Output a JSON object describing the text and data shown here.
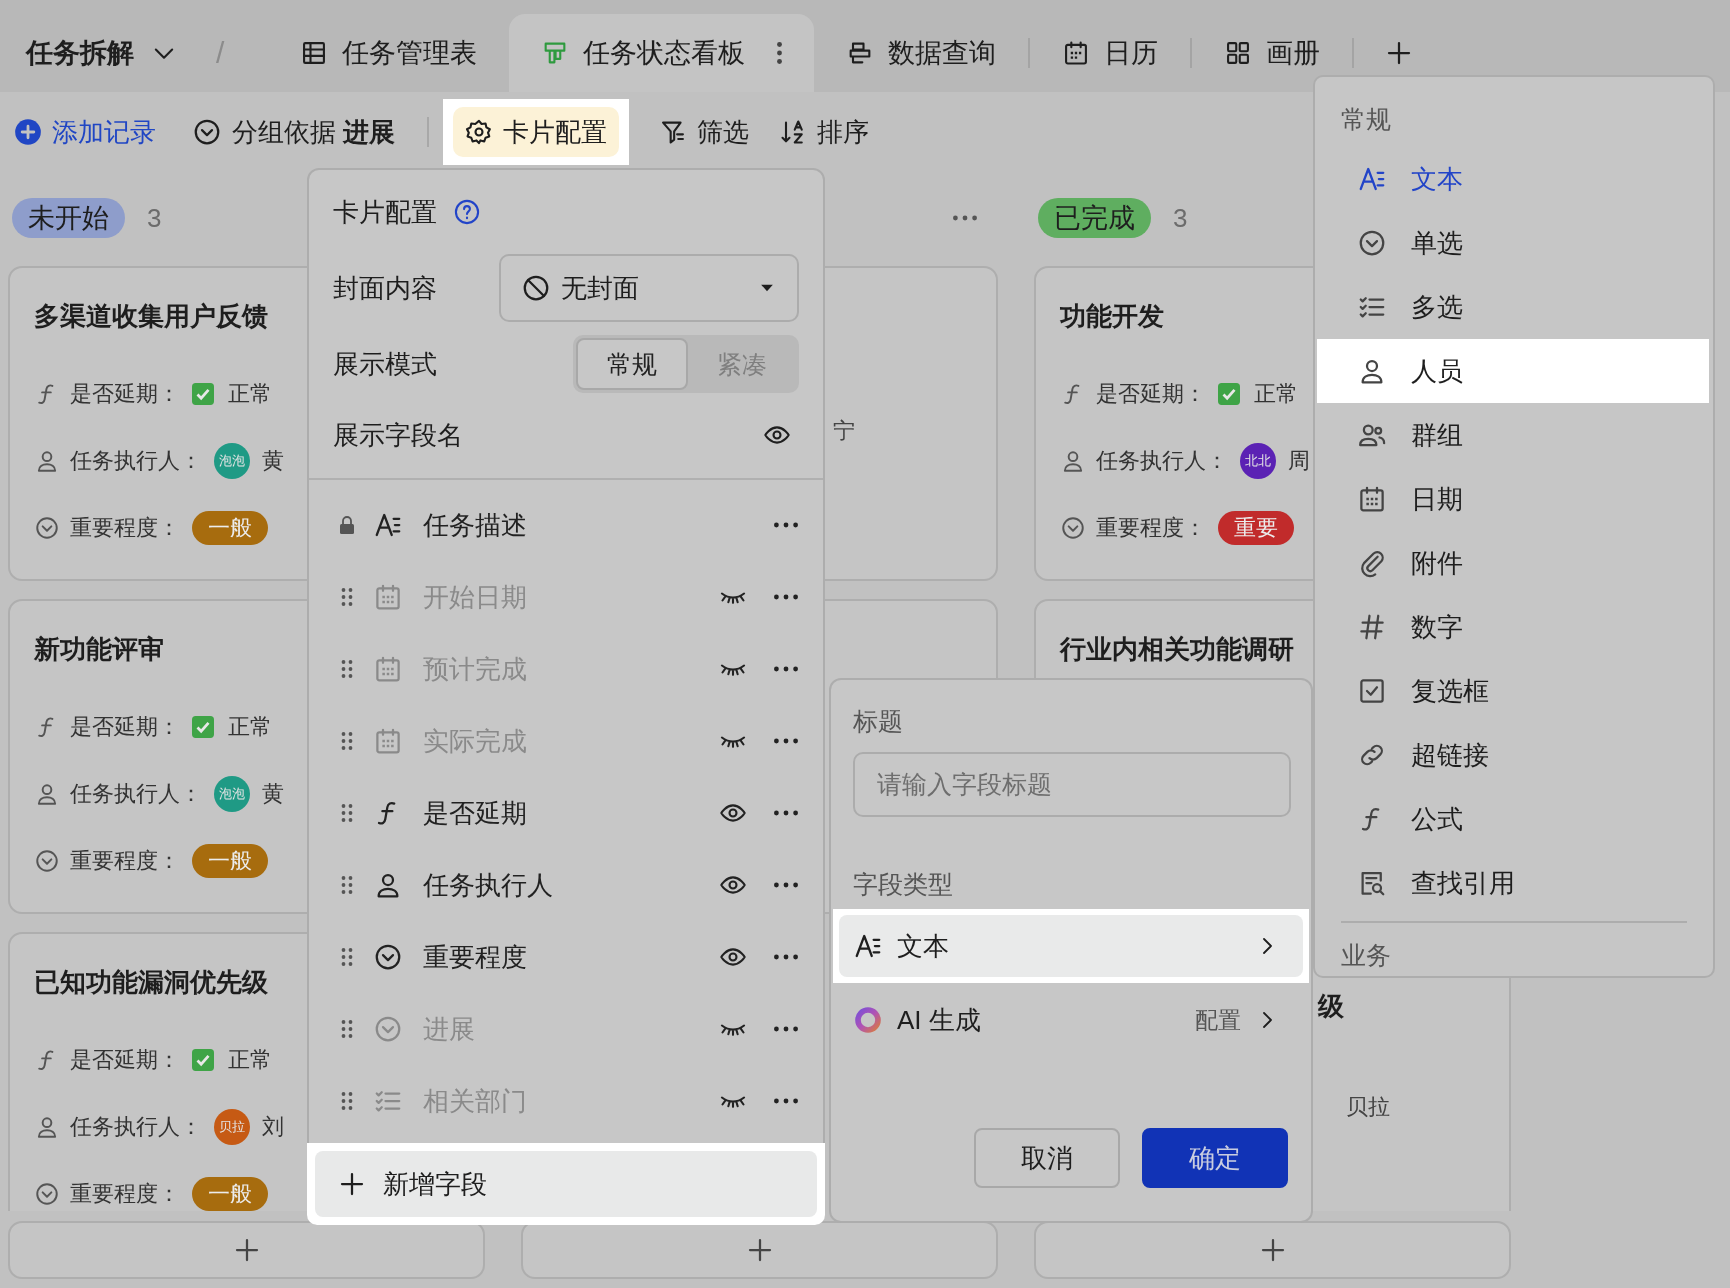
{
  "header": {
    "title": "任务拆解",
    "separator": "/"
  },
  "tabs": [
    {
      "label": "任务管理表",
      "kind": "grid",
      "selected": false,
      "has_menu": false
    },
    {
      "label": "任务状态看板",
      "kind": "kanban",
      "selected": true,
      "has_menu": true
    },
    {
      "label": "数据查询",
      "kind": "query",
      "selected": false,
      "has_menu": false
    },
    {
      "label": "日历",
      "kind": "calendar",
      "selected": false,
      "has_menu": false
    },
    {
      "label": "画册",
      "kind": "gallery",
      "selected": false,
      "has_menu": false
    }
  ],
  "toolbar": {
    "add_record": "添加记录",
    "group_by": "分组依据 **进展**",
    "buttons": [
      {
        "label": "卡片配置",
        "kind": "gear",
        "highlighted": true
      },
      {
        "label": "筛选",
        "kind": "filter",
        "highlighted": false
      },
      {
        "label": "排序",
        "kind": "sort",
        "highlighted": false
      }
    ]
  },
  "columns": [
    {
      "kind": "status",
      "status": "未开始",
      "color": "#8e9dcb",
      "count": "3",
      "cards": [
        {
          "kind": "full",
          "title": "多渠道收集用户反馈",
          "fields": [
            {
              "kind": "check",
              "label": "是否延期：",
              "checked": true,
              "value": "正常"
            },
            {
              "kind": "person",
              "label": "任务执行人：",
              "avatar": "泡泡",
              "color": "#1f9a85",
              "value": "黄"
            },
            {
              "kind": "tag",
              "label": "重要程度：",
              "value": "一般",
              "color": "#a76c0e"
            }
          ]
        },
        {
          "kind": "full",
          "title": "新功能评审",
          "fields": [
            {
              "kind": "check",
              "label": "是否延期：",
              "checked": true,
              "value": "正常"
            },
            {
              "kind": "person",
              "label": "任务执行人：",
              "avatar": "泡泡",
              "color": "#1f9a85",
              "value": "黄"
            },
            {
              "kind": "tag",
              "label": "重要程度：",
              "value": "一般",
              "color": "#a76c0e"
            }
          ]
        },
        {
          "kind": "full",
          "title": "已知功能漏洞优先级",
          "fields": [
            {
              "kind": "check",
              "label": "是否延期：",
              "checked": true,
              "value": "正常"
            },
            {
              "kind": "person",
              "label": "任务执行人：",
              "avatar": "贝拉",
              "color": "#c65a14",
              "value": "刘"
            },
            {
              "kind": "tag",
              "label": "重要程度：",
              "value": "一般",
              "color": "#a76c0e"
            }
          ]
        }
      ]
    },
    {
      "kind": "covered",
      "cards": [
        {
          "kind": "covered",
          "executor": "宁"
        },
        {
          "kind": "covered"
        }
      ]
    },
    {
      "kind": "status",
      "status": "已完成",
      "color": "#5fae60",
      "count": "3",
      "cards": [
        {
          "kind": "full",
          "title": "功能开发",
          "fields": [
            {
              "kind": "check",
              "label": "是否延期：",
              "checked": true,
              "value": "正常"
            },
            {
              "kind": "person",
              "label": "任务执行人：",
              "avatar": "北北",
              "color": "#5b22b4",
              "value": "周"
            },
            {
              "kind": "tag",
              "label": "重要程度：",
              "value": "重要",
              "color": "#c12b2b"
            }
          ]
        },
        {
          "kind": "covered",
          "title": "行业内相关功能调研"
        },
        {
          "kind": "covered",
          "title_fragment": "级",
          "executor": "贝拉"
        }
      ]
    }
  ],
  "card_config": {
    "title": "卡片配置",
    "cover": {
      "label": "封面内容",
      "value": "无封面"
    },
    "display_mode": {
      "label": "展示模式",
      "options": [
        {
          "label": "常规",
          "selected": true
        },
        {
          "label": "紧凑",
          "selected": false
        }
      ]
    },
    "show_field_names": {
      "label": "展示字段名",
      "on": true
    },
    "fields": [
      {
        "label": "任务描述",
        "kind": "text",
        "locked": true,
        "visible": true
      },
      {
        "label": "开始日期",
        "kind": "date",
        "locked": false,
        "visible": false
      },
      {
        "label": "预计完成",
        "kind": "date",
        "locked": false,
        "visible": false
      },
      {
        "label": "实际完成",
        "kind": "date",
        "locked": false,
        "visible": false
      },
      {
        "label": "是否延期",
        "kind": "formula",
        "locked": false,
        "visible": true
      },
      {
        "label": "任务执行人",
        "kind": "person",
        "locked": false,
        "visible": true
      },
      {
        "label": "重要程度",
        "kind": "single",
        "locked": false,
        "visible": true
      },
      {
        "label": "进展",
        "kind": "single",
        "locked": false,
        "visible": false
      },
      {
        "label": "相关部门",
        "kind": "multi",
        "locked": false,
        "visible": false
      }
    ],
    "add_field": "新增字段"
  },
  "field_editor": {
    "title_label": "标题",
    "title_placeholder": "请输入字段标题",
    "type_label": "字段类型",
    "type_options": [
      {
        "kind": "text",
        "label": "文本",
        "highlighted": true
      },
      {
        "kind": "ai",
        "label": "AI 生成",
        "action": "配置",
        "highlighted": false
      }
    ],
    "cancel": "取消",
    "confirm": "确定"
  },
  "type_menu": {
    "sections": [
      {
        "title": "常规",
        "items": [
          {
            "label": "文本",
            "kind": "text",
            "selected": true,
            "highlighted": false
          },
          {
            "label": "单选",
            "kind": "single",
            "selected": false,
            "highlighted": false
          },
          {
            "label": "多选",
            "kind": "multi",
            "selected": false,
            "highlighted": false
          },
          {
            "label": "人员",
            "kind": "person",
            "selected": false,
            "highlighted": true
          },
          {
            "label": "群组",
            "kind": "group",
            "selected": false,
            "highlighted": false
          },
          {
            "label": "日期",
            "kind": "date",
            "selected": false,
            "highlighted": false
          },
          {
            "label": "附件",
            "kind": "attach",
            "selected": false,
            "highlighted": false
          },
          {
            "label": "数字",
            "kind": "number",
            "selected": false,
            "highlighted": false
          },
          {
            "label": "复选框",
            "kind": "checkbox",
            "selected": false,
            "highlighted": false
          },
          {
            "label": "超链接",
            "kind": "link",
            "selected": false,
            "highlighted": false
          },
          {
            "label": "公式",
            "kind": "formula",
            "selected": false,
            "highlighted": false
          },
          {
            "label": "查找引用",
            "kind": "lookup",
            "selected": false,
            "highlighted": false
          }
        ]
      },
      {
        "title": "业务"
      }
    ]
  }
}
